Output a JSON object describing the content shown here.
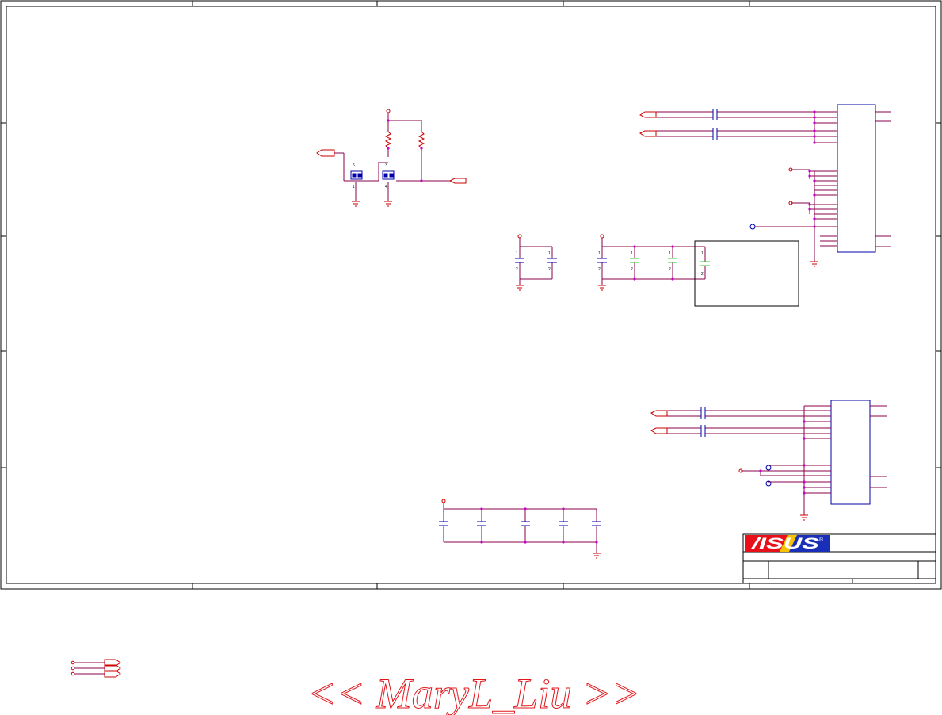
{
  "logo": {
    "text": "/ISUS",
    "registered_mark": "®"
  },
  "watermark": {
    "text": "<< MaryL_Liu >>"
  },
  "pin_labels": {
    "q1": [
      "6",
      "1"
    ],
    "q2": [
      "3",
      "4"
    ],
    "cap": [
      "1",
      "2"
    ]
  },
  "colors": {
    "border": "#000000",
    "wire": "#8b004b",
    "net": "#cc0000",
    "component": "#0000aa",
    "junction": "#cc00cc",
    "cap_green": "#33cc33",
    "logo_red": "#e8111b",
    "logo_blue": "#1a2fb8"
  }
}
